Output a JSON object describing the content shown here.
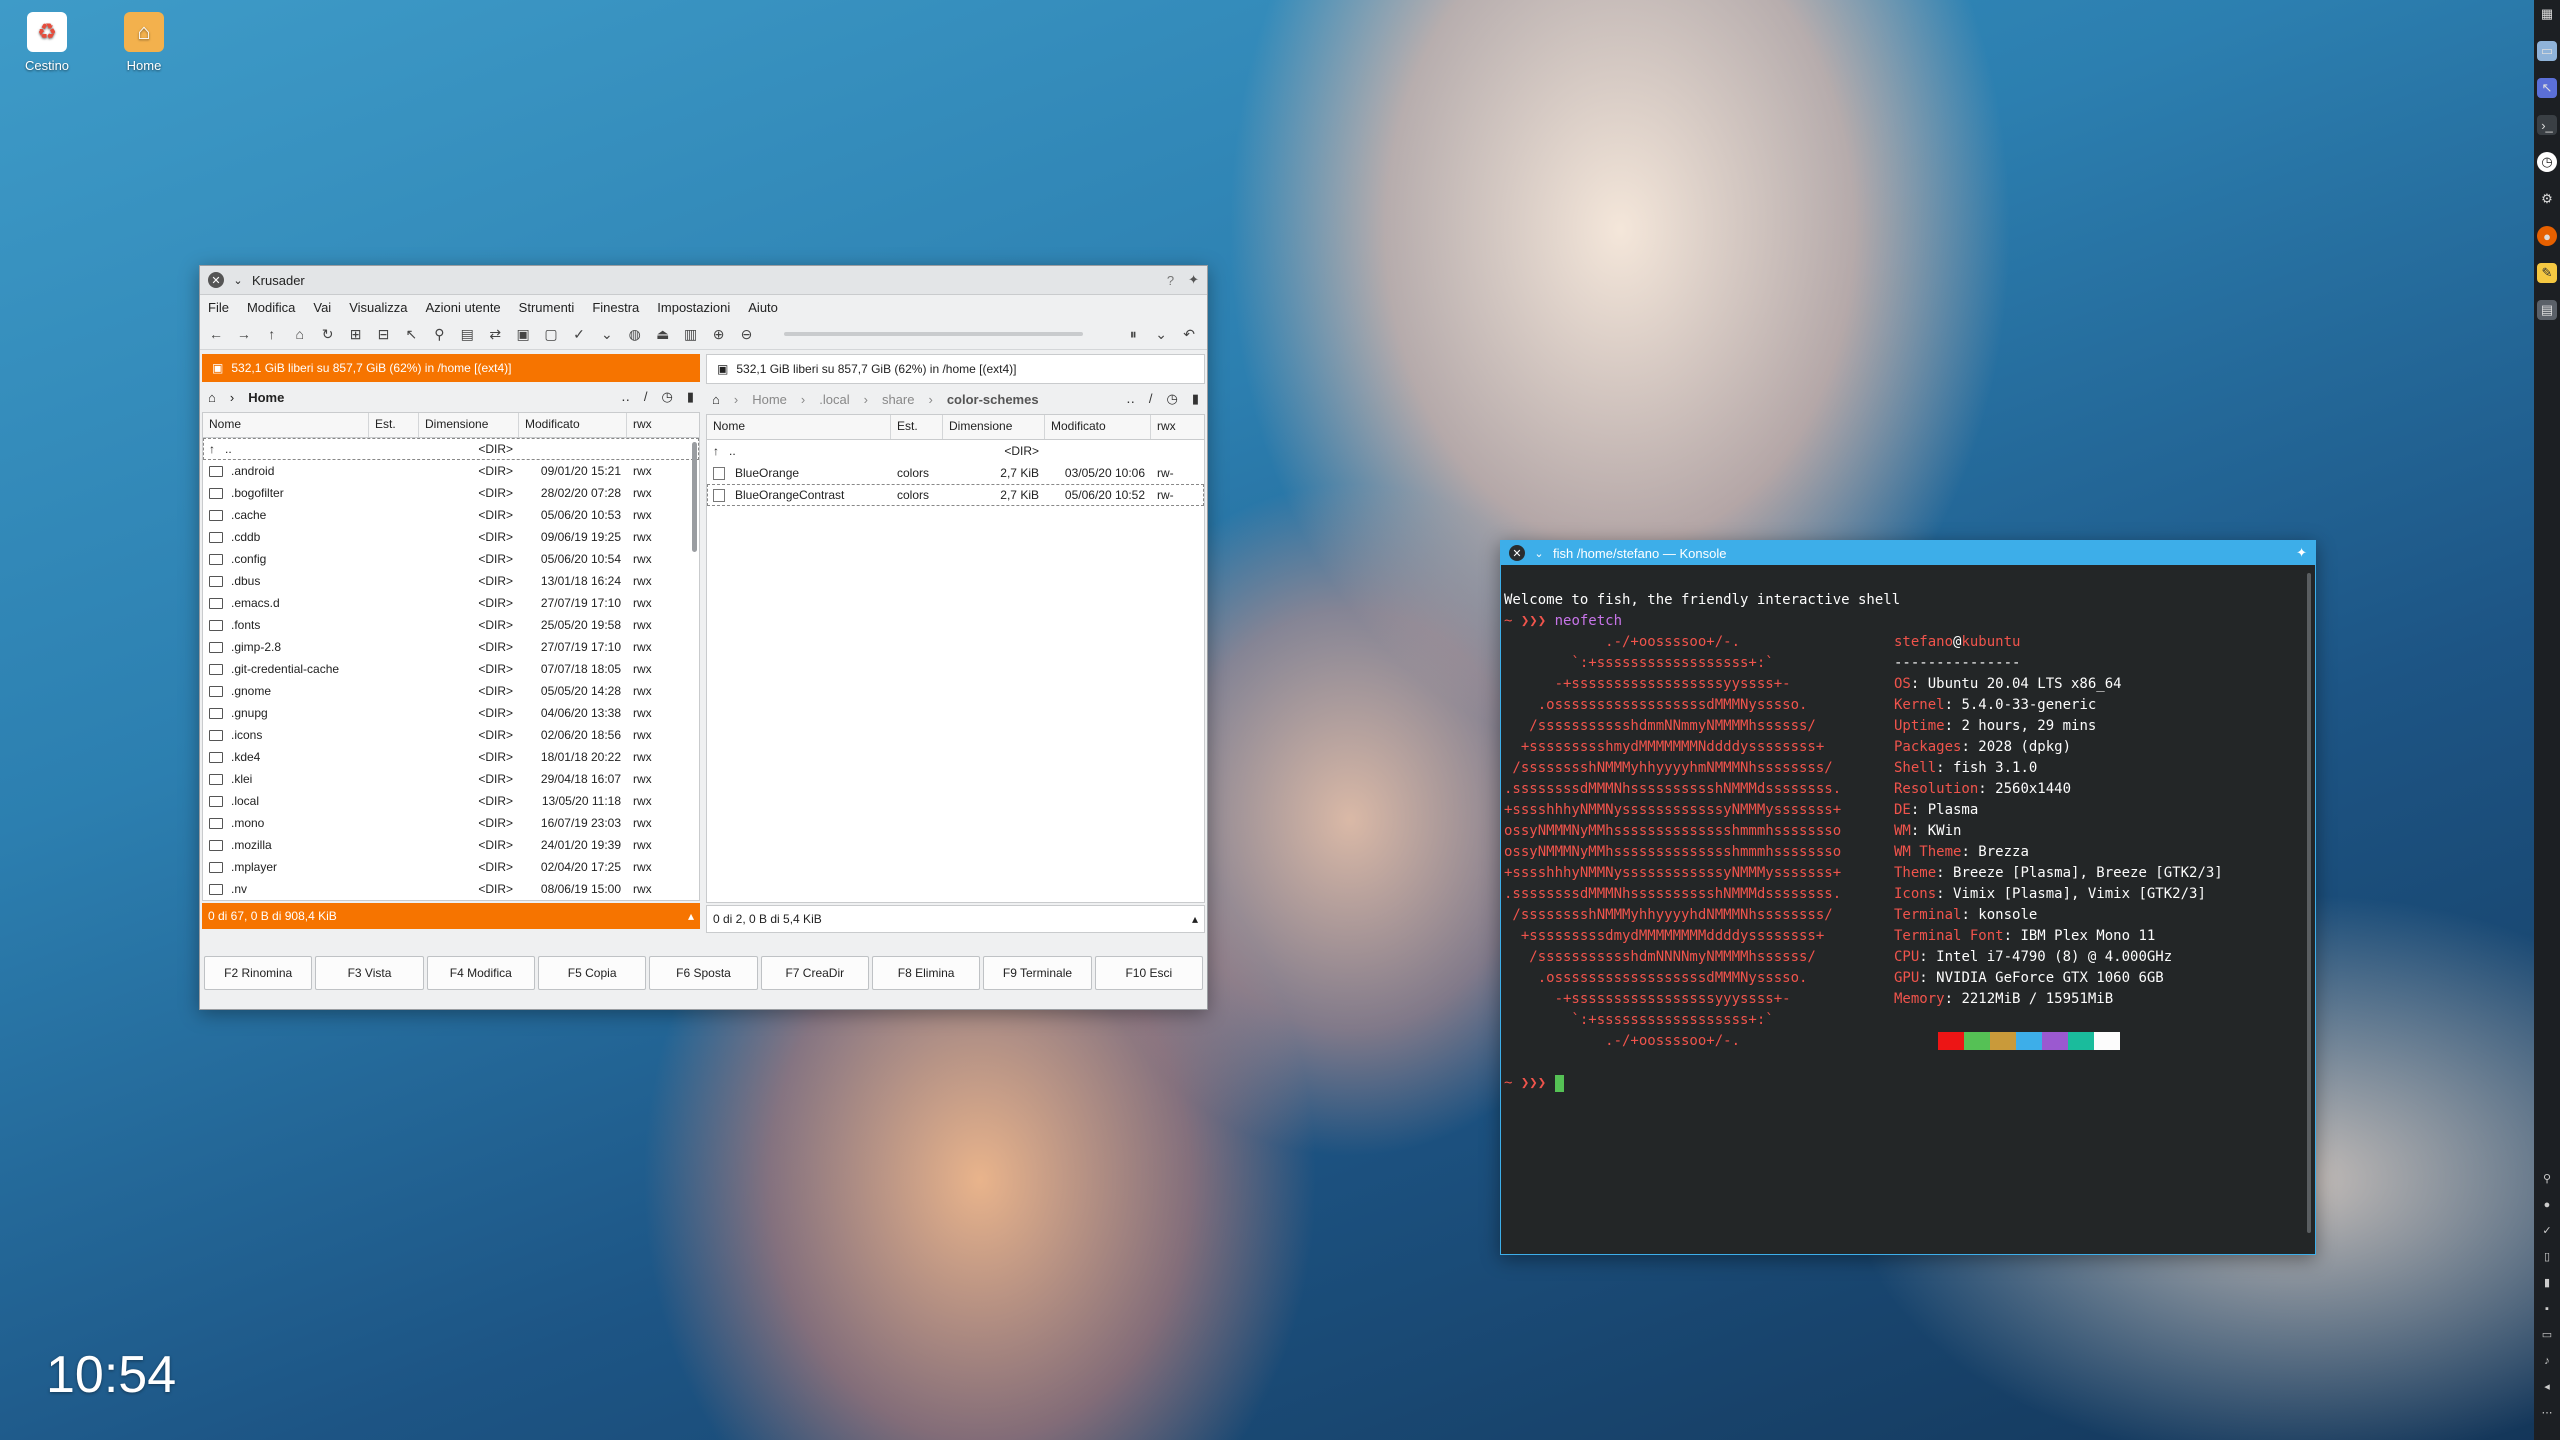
{
  "desktop": {
    "icons": [
      {
        "label": "Cestino"
      },
      {
        "label": "Home"
      }
    ],
    "clock": "10:54"
  },
  "krusader": {
    "title": "Krusader",
    "menu": [
      "File",
      "Modifica",
      "Vai",
      "Visualizza",
      "Azioni utente",
      "Strumenti",
      "Finestra",
      "Impostazioni",
      "Aiuto"
    ],
    "left": {
      "free": "532,1 GiB liberi su 857,7 GiB (62%) in /home [(ext4)]",
      "crumbs": [
        "Home"
      ],
      "columns": [
        "Nome",
        "Est.",
        "Dimensione",
        "Modificato",
        "rwx"
      ],
      "rows": [
        {
          "name": "..",
          "ext": "",
          "size": "<DIR>",
          "date": "",
          "rwx": ""
        },
        {
          "name": ".android",
          "ext": "",
          "size": "<DIR>",
          "date": "09/01/20 15:21",
          "rwx": "rwx"
        },
        {
          "name": ".bogofilter",
          "ext": "",
          "size": "<DIR>",
          "date": "28/02/20 07:28",
          "rwx": "rwx"
        },
        {
          "name": ".cache",
          "ext": "",
          "size": "<DIR>",
          "date": "05/06/20 10:53",
          "rwx": "rwx"
        },
        {
          "name": ".cddb",
          "ext": "",
          "size": "<DIR>",
          "date": "09/06/19 19:25",
          "rwx": "rwx"
        },
        {
          "name": ".config",
          "ext": "",
          "size": "<DIR>",
          "date": "05/06/20 10:54",
          "rwx": "rwx"
        },
        {
          "name": ".dbus",
          "ext": "",
          "size": "<DIR>",
          "date": "13/01/18 16:24",
          "rwx": "rwx"
        },
        {
          "name": ".emacs.d",
          "ext": "",
          "size": "<DIR>",
          "date": "27/07/19 17:10",
          "rwx": "rwx"
        },
        {
          "name": ".fonts",
          "ext": "",
          "size": "<DIR>",
          "date": "25/05/20 19:58",
          "rwx": "rwx"
        },
        {
          "name": ".gimp-2.8",
          "ext": "",
          "size": "<DIR>",
          "date": "27/07/19 17:10",
          "rwx": "rwx"
        },
        {
          "name": ".git-credential-cache",
          "ext": "",
          "size": "<DIR>",
          "date": "07/07/18 18:05",
          "rwx": "rwx"
        },
        {
          "name": ".gnome",
          "ext": "",
          "size": "<DIR>",
          "date": "05/05/20 14:28",
          "rwx": "rwx"
        },
        {
          "name": ".gnupg",
          "ext": "",
          "size": "<DIR>",
          "date": "04/06/20 13:38",
          "rwx": "rwx"
        },
        {
          "name": ".icons",
          "ext": "",
          "size": "<DIR>",
          "date": "02/06/20 18:56",
          "rwx": "rwx"
        },
        {
          "name": ".kde4",
          "ext": "",
          "size": "<DIR>",
          "date": "18/01/18 20:22",
          "rwx": "rwx"
        },
        {
          "name": ".klei",
          "ext": "",
          "size": "<DIR>",
          "date": "29/04/18 16:07",
          "rwx": "rwx"
        },
        {
          "name": ".local",
          "ext": "",
          "size": "<DIR>",
          "date": "13/05/20 11:18",
          "rwx": "rwx"
        },
        {
          "name": ".mono",
          "ext": "",
          "size": "<DIR>",
          "date": "16/07/19 23:03",
          "rwx": "rwx"
        },
        {
          "name": ".mozilla",
          "ext": "",
          "size": "<DIR>",
          "date": "24/01/20 19:39",
          "rwx": "rwx"
        },
        {
          "name": ".mplayer",
          "ext": "",
          "size": "<DIR>",
          "date": "02/04/20 17:25",
          "rwx": "rwx"
        },
        {
          "name": ".nv",
          "ext": "",
          "size": "<DIR>",
          "date": "08/06/19 15:00",
          "rwx": "rwx"
        }
      ],
      "status": "0 di 67, 0 B di 908,4 KiB"
    },
    "right": {
      "free": "532,1 GiB liberi su 857,7 GiB (62%) in /home [(ext4)]",
      "crumbs": [
        "Home",
        ".local",
        "share",
        "color-schemes"
      ],
      "columns": [
        "Nome",
        "Est.",
        "Dimensione",
        "Modificato",
        "rwx"
      ],
      "rows": [
        {
          "name": "..",
          "ext": "",
          "size": "<DIR>",
          "date": "",
          "rwx": ""
        },
        {
          "name": "BlueOrange",
          "ext": "colors",
          "size": "2,7 KiB",
          "date": "03/05/20 10:06",
          "rwx": "rw-"
        },
        {
          "name": "BlueOrangeContrast",
          "ext": "colors",
          "size": "2,7 KiB",
          "date": "05/06/20 10:52",
          "rwx": "rw-"
        }
      ],
      "status": "0 di 2, 0 B di 5,4 KiB"
    },
    "fkeys": [
      "F2 Rinomina",
      "F3 Vista",
      "F4 Modifica",
      "F5 Copia",
      "F6 Sposta",
      "F7 CreaDir",
      "F8 Elimina",
      "F9 Terminale",
      "F10 Esci"
    ]
  },
  "konsole": {
    "title": "fish /home/stefano — Konsole",
    "welcome": "Welcome to fish, the friendly interactive shell",
    "prompt": "~ ❯❯❯",
    "command": "neofetch",
    "logo": [
      "            .-/+oossssoo+/-.",
      "        `:+ssssssssssssssssss+:`",
      "      -+ssssssssssssssssssyyssss+-",
      "    .ossssssssssssssssssdMMMNysssso.",
      "   /ssssssssssshdmmNNmmyNMMMMhssssss/",
      "  +ssssssssshmydMMMMMMMNddddyssssssss+",
      " /sssssssshNMMMyhhyyyyhmNMMMNhssssssss/",
      ".ssssssssdMMMNhsssssssssshNMMMdssssssss.",
      "+sssshhhyNMMNyssssssssssssyNMMMysssssss+",
      "ossyNMMMNyMMhsssssssssssssshmmmhssssssso",
      "ossyNMMMNyMMhsssssssssssssshmmmhssssssso",
      "+sssshhhyNMMNyssssssssssssyNMMMysssssss+",
      ".ssssssssdMMMNhsssssssssshNMMMdssssssss.",
      " /sssssssshNMMMyhhyyyyhdNMMMNhssssssss/",
      "  +sssssssssdmydMMMMMMMMddddyssssssss+",
      "   /ssssssssssshdmNNNNmyNMMMMhssssss/",
      "    .ossssssssssssssssssdMMMNysssso.",
      "      -+sssssssssssssssssyyyssss+-",
      "        `:+ssssssssssssssssss+:`",
      "            .-/+oossssoo+/-."
    ],
    "user": "stefano",
    "at": "@",
    "host": "kubuntu",
    "sep": "---------------",
    "info": [
      {
        "k": "OS",
        "v": "Ubuntu 20.04 LTS x86_64"
      },
      {
        "k": "Kernel",
        "v": "5.4.0-33-generic"
      },
      {
        "k": "Uptime",
        "v": "2 hours, 29 mins"
      },
      {
        "k": "Packages",
        "v": "2028 (dpkg)"
      },
      {
        "k": "Shell",
        "v": "fish 3.1.0"
      },
      {
        "k": "Resolution",
        "v": "2560x1440"
      },
      {
        "k": "DE",
        "v": "Plasma"
      },
      {
        "k": "WM",
        "v": "KWin"
      },
      {
        "k": "WM Theme",
        "v": "Brezza"
      },
      {
        "k": "Theme",
        "v": "Breeze [Plasma], Breeze [GTK2/3]"
      },
      {
        "k": "Icons",
        "v": "Vimix [Plasma], Vimix [GTK2/3]"
      },
      {
        "k": "Terminal",
        "v": "konsole"
      },
      {
        "k": "Terminal Font",
        "v": "IBM Plex Mono 11"
      },
      {
        "k": "CPU",
        "v": "Intel i7-4790 (8) @ 4.000GHz"
      },
      {
        "k": "GPU",
        "v": "NVIDIA GeForce GTX 1060 6GB"
      },
      {
        "k": "Memory",
        "v": "2212MiB / 15951MiB"
      }
    ],
    "info_sep": ": ",
    "swatches": [
      "#232627",
      "#ed1515",
      "#55c155",
      "#c99a3a",
      "#3daee9",
      "#9b59d0",
      "#1abc9c",
      "#fcfcfc"
    ],
    "prompt2": "~ ❯❯❯"
  }
}
